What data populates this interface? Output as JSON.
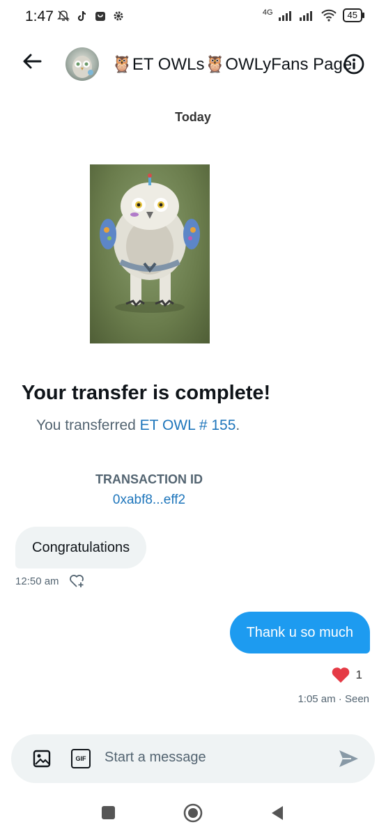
{
  "status_bar": {
    "time": "1:47",
    "network": "4G",
    "battery": "45"
  },
  "header": {
    "title": "🦉ET OWLs🦉OWLyFans Page",
    "back_icon": "arrow-left-icon",
    "info_icon": "info-icon"
  },
  "conversation": {
    "date_separator": "Today",
    "transfer_card": {
      "title": "Your transfer is complete!",
      "description_prefix": "You transferred ",
      "nft_name": "ET OWL # 155",
      "description_suffix": ".",
      "transaction_label": "TRANSACTION ID",
      "transaction_id": "0xabf8...eff2"
    },
    "messages": [
      {
        "direction": "incoming",
        "text": "Congratulations",
        "time": "12:50 am"
      },
      {
        "direction": "outgoing",
        "text": "Thank u so much",
        "reaction_emoji": "❤️",
        "reaction_count": "1",
        "time": "1:05 am · Seen"
      }
    ]
  },
  "composer": {
    "placeholder": "Start a message",
    "gif_label": "GIF"
  },
  "colors": {
    "accent": "#1d9bf0",
    "link": "#1d75bb",
    "bubble_in": "#eff3f4",
    "muted": "#536471"
  }
}
